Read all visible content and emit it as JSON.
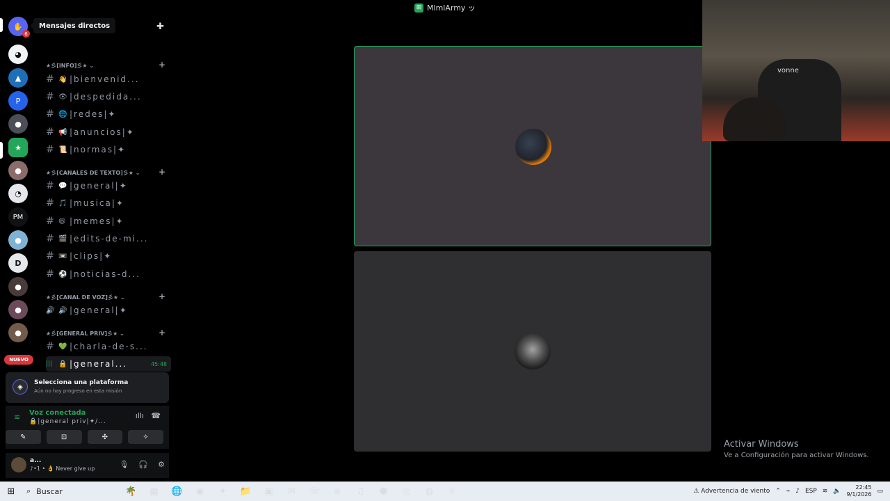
{
  "titlebar": {
    "title": "MlmlArmy ッ",
    "logo_glyph": "⊞"
  },
  "tooltip": {
    "text": "Mensajes directos"
  },
  "servers": {
    "items": [
      {
        "name": "direct-messages",
        "glyph": "✋",
        "color": "#5865f2",
        "badge": "6"
      },
      {
        "name": "server-1",
        "glyph": "◕",
        "color": "#f2f3f5"
      },
      {
        "name": "server-2",
        "glyph": "▲",
        "color": "#1f6fb8"
      },
      {
        "name": "server-3",
        "glyph": "P",
        "color": "#2563eb"
      },
      {
        "name": "server-4",
        "glyph": "●",
        "color": "#4b4e57"
      },
      {
        "name": "server-5",
        "glyph": "★",
        "color": "#23a55a"
      },
      {
        "name": "server-6",
        "glyph": "●",
        "color": "#8c6b6b"
      },
      {
        "name": "server-7",
        "glyph": "◔",
        "color": "#e5e7eb"
      },
      {
        "name": "server-pm",
        "glyph": "PM",
        "color": "#111214"
      },
      {
        "name": "server-8",
        "glyph": "●",
        "color": "#7fb3d5"
      },
      {
        "name": "server-9",
        "glyph": "D",
        "color": "#e5e7eb"
      },
      {
        "name": "server-10",
        "glyph": "●",
        "color": "#4a3b3b"
      },
      {
        "name": "server-11",
        "glyph": "●",
        "color": "#6b4a5a"
      },
      {
        "name": "server-12",
        "glyph": "●",
        "color": "#735a4a"
      }
    ],
    "new_badge": "NUEVO"
  },
  "sidebar": {
    "categories": [
      {
        "label": "★彡[INFO]彡★ ⌄"
      },
      {
        "label": "★彡[CANALES DE TEXTO]彡★ ⌄"
      },
      {
        "label": "★彡[CANAL DE VOZ]彡★ ⌄"
      },
      {
        "label": "★彡[GENERAL PRIV]彡★ ⌄"
      }
    ],
    "channels": [
      {
        "prefix": "#",
        "emoji": "👋",
        "label": "|bienvenid..."
      },
      {
        "prefix": "#",
        "emoji": "👁",
        "label": "|despedida..."
      },
      {
        "prefix": "#",
        "emoji": "🌐",
        "label": "|redes|✦"
      },
      {
        "prefix": "#",
        "emoji": "📢",
        "label": "|anuncios|✦"
      },
      {
        "prefix": "#",
        "emoji": "📜",
        "label": "|normas|✦"
      },
      {
        "prefix": "#",
        "emoji": "💬",
        "label": "|general|✦"
      },
      {
        "prefix": "#",
        "emoji": "🎵",
        "label": "|musica|✦"
      },
      {
        "prefix": "#",
        "emoji": "😆",
        "label": "|memes|✦"
      },
      {
        "prefix": "#",
        "emoji": "🎬",
        "label": "|edits-de-mi..."
      },
      {
        "prefix": "#",
        "emoji": "📼",
        "label": "|clips|✦"
      },
      {
        "prefix": "#",
        "emoji": "⚽",
        "label": "|noticias-d..."
      },
      {
        "prefix": "🔊",
        "emoji": "🔊",
        "label": "|general|✦"
      },
      {
        "prefix": "#",
        "emoji": "💚",
        "label": "|charla-de-s..."
      },
      {
        "prefix": "|||",
        "emoji": "🔒",
        "label": "|general...",
        "time": "45:48"
      }
    ]
  },
  "quest": {
    "title": "Selecciona una plataforma",
    "subtitle": "Aún no hay progreso en esta misión"
  },
  "voice": {
    "title": "Voz conectada",
    "channel": "🔒|general priv|✦/..."
  },
  "voice_buttons": {
    "camera": "✎",
    "screen": "⊡",
    "activity": "✣",
    "soundboard": "✧"
  },
  "user": {
    "name": "a...",
    "status": "♪•1 • 👌 Never give up"
  },
  "webcam": {
    "chair_brand": "vonne"
  },
  "windows_activation": {
    "line1": "Activar Windows",
    "line2": "Ve a Configuración para activar Windows."
  },
  "taskbar": {
    "search_label": "Buscar",
    "apps": [
      "🌴",
      "▦",
      "🌐",
      "◉",
      "✦",
      "📁",
      "▣",
      "✉",
      "☏",
      "⎈",
      "♫",
      "⬢",
      "◎",
      "◍",
      "⚛"
    ],
    "weather": "⚠ Advertencia de viento",
    "language": "ESP",
    "time": "22:45",
    "date": "9/1/2026"
  }
}
